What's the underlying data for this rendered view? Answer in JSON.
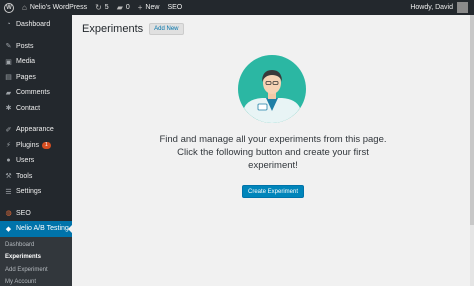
{
  "adminbar": {
    "site_name": "Nelio's WordPress",
    "updates_count": "5",
    "comments_count": "0",
    "new_label": "New",
    "seo_label": "SEO",
    "howdy": "Howdy, David"
  },
  "sidebar": {
    "items": [
      {
        "label": "Dashboard",
        "icon": "dashboard-icon"
      },
      {
        "label": "Posts",
        "icon": "pin-icon"
      },
      {
        "label": "Media",
        "icon": "media-icon"
      },
      {
        "label": "Pages",
        "icon": "page-icon"
      },
      {
        "label": "Comments",
        "icon": "comment-icon"
      },
      {
        "label": "Contact",
        "icon": "gear-icon"
      },
      {
        "label": "Appearance",
        "icon": "brush-icon"
      },
      {
        "label": "Plugins",
        "icon": "plug-icon",
        "badge": "1"
      },
      {
        "label": "Users",
        "icon": "user-icon"
      },
      {
        "label": "Tools",
        "icon": "wrench-icon"
      },
      {
        "label": "Settings",
        "icon": "settings-icon"
      },
      {
        "label": "SEO",
        "icon": "seo-icon"
      },
      {
        "label": "Nelio A/B Testing",
        "icon": "nelio-icon"
      }
    ],
    "submenu": [
      {
        "label": "Dashboard"
      },
      {
        "label": "Experiments"
      },
      {
        "label": "Add Experiment"
      },
      {
        "label": "My Account"
      }
    ]
  },
  "main": {
    "title": "Experiments",
    "add_new": "Add New",
    "message_line1": "Find and manage all your experiments from this page.",
    "message_line2": "Click the following button and create your first",
    "message_line3": "experiment!",
    "create_button": "Create Experiment"
  },
  "colors": {
    "accent": "#0073aa",
    "button": "#0085ba",
    "illustration_bg": "#2bb7a3"
  }
}
